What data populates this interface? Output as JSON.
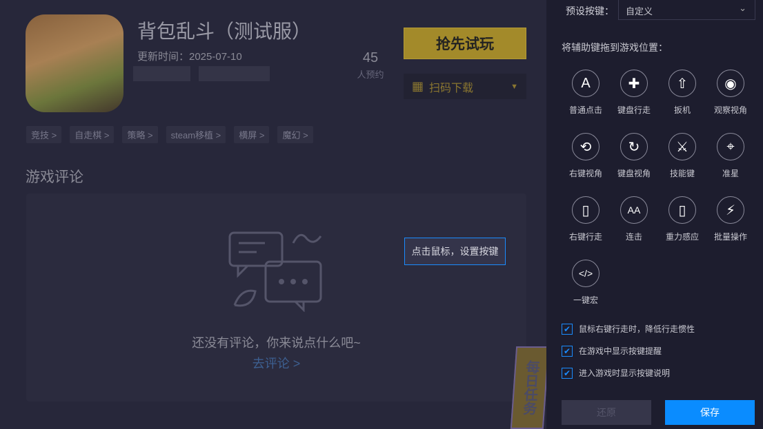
{
  "game": {
    "title": "背包乱斗（测试服）",
    "update": "更新时间：2025-07-10",
    "reserve_count": "45",
    "reserve_label": "人预约",
    "play_button": "抢先试玩",
    "download_button": "扫码下载",
    "tags": [
      "竞技 >",
      "自走棋 >",
      "策略 >",
      "steam移植 >",
      "横屏 >",
      "魔幻 >"
    ]
  },
  "comments": {
    "heading": "游戏评论",
    "empty": "还没有评论，你来说点什么吧~",
    "link": "去评论 >"
  },
  "tooltip": "点击鼠标，设置按键",
  "badge": "每日任务",
  "panel": {
    "preset_label": "预设按键：",
    "preset_value": "自定义",
    "drag_hint": "将辅助键拖到游戏位置：",
    "keys": [
      {
        "label": "普通点击",
        "icon": "letter-a-icon",
        "glyph": "A"
      },
      {
        "label": "键盘行走",
        "icon": "dpad-cross-icon",
        "glyph": "✚"
      },
      {
        "label": "扳机",
        "icon": "bullet-icon",
        "glyph": "⇧"
      },
      {
        "label": "观察视角",
        "icon": "eye-icon",
        "glyph": "◉"
      },
      {
        "label": "右键视角",
        "icon": "mouse-rotate-icon",
        "glyph": "⟲"
      },
      {
        "label": "键盘视角",
        "icon": "rotate-axis-icon",
        "glyph": "↻"
      },
      {
        "label": "技能键",
        "icon": "crossed-swords-icon",
        "glyph": "⚔"
      },
      {
        "label": "准星",
        "icon": "crosshair-icon",
        "glyph": "⌖"
      },
      {
        "label": "右键行走",
        "icon": "mouse-icon",
        "glyph": "▯"
      },
      {
        "label": "连击",
        "icon": "double-a-icon",
        "glyph": "AA"
      },
      {
        "label": "重力感应",
        "icon": "phone-gravity-icon",
        "glyph": "▯"
      },
      {
        "label": "批量操作",
        "icon": "lightning-icon",
        "glyph": "⚡"
      },
      {
        "label": "一键宏",
        "icon": "script-scroll-icon",
        "glyph": "</>"
      }
    ],
    "options": [
      {
        "label": "鼠标右键行走时，降低行走惯性",
        "checked": true
      },
      {
        "label": "在游戏中显示按键提醒",
        "checked": true
      },
      {
        "label": "进入游戏时显示按键说明",
        "checked": true
      }
    ],
    "reset_button": "还原",
    "save_button": "保存"
  },
  "colors": {
    "accent": "#0a8cff",
    "gold": "#a38a2a"
  }
}
